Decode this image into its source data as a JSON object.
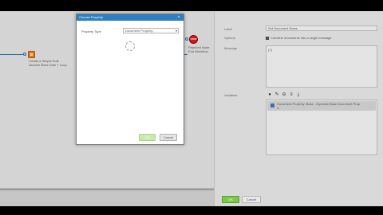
{
  "canvas": {
    "node_label": "Create a Simple Rule\nAssume Base Date + Loop",
    "stop_badge": "STOP",
    "stop_label": "Rejected Node\nEnd Workflow"
  },
  "panel": {
    "label_caption": "Label",
    "label_value": "Set Document Name",
    "options_caption": "Options",
    "options_checkbox_label": "Combine documents into a single message",
    "message_caption": "Message",
    "message_value": "{?}",
    "variables_caption": "Variables",
    "variable_tools": [
      "add-icon",
      "edit-icon",
      "remove-icon",
      "sort-icon",
      "download-icon"
    ],
    "variable_rows": [
      "Document Property: Base - Dynamic Base Document Prop\nA"
    ],
    "ok_label": "OK",
    "cancel_label": "Cancel"
  },
  "dialog": {
    "title": "Choose Property",
    "property_type_label": "Property Type",
    "property_type_value": "Document Property",
    "ok_label": "OK",
    "cancel_label": "Cancel"
  },
  "colors": {
    "title_bar": "#2e7fc1",
    "ok_green": "#7cc84a",
    "node_orange": "#e07820",
    "stop_red": "#d01818"
  }
}
